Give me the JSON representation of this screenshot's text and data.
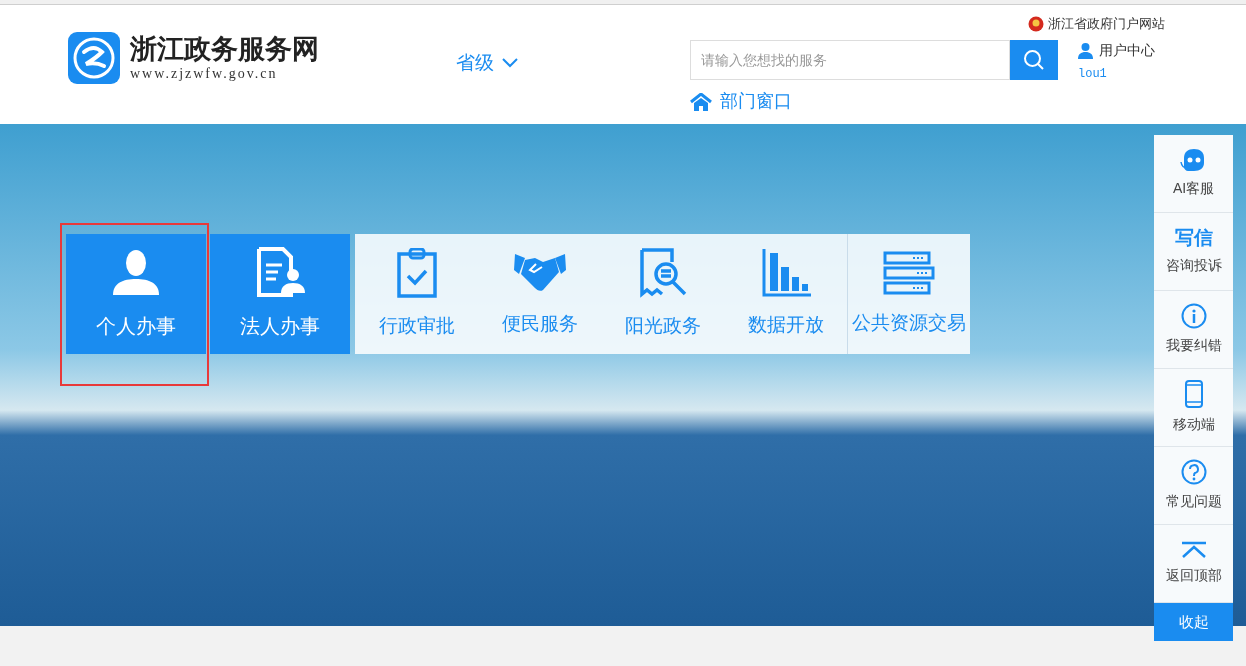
{
  "header": {
    "logo_title": "浙江政务服务网",
    "logo_url": "www.zjzwfw.gov.cn",
    "region": "省级",
    "portal_link": "浙江省政府门户网站",
    "search": {
      "placeholder": "请输入您想找的服务"
    },
    "dept_link": "部门窗口",
    "user_center": "用户中心",
    "username": "lou1"
  },
  "tiles": [
    {
      "label": "个人办事",
      "kind": "primary",
      "highlighted": true
    },
    {
      "label": "法人办事",
      "kind": "primary",
      "highlighted": false
    },
    {
      "label": "行政审批",
      "kind": "secondary",
      "highlighted": false
    },
    {
      "label": "便民服务",
      "kind": "secondary",
      "highlighted": false
    },
    {
      "label": "阳光政务",
      "kind": "secondary",
      "highlighted": false
    },
    {
      "label": "数据开放",
      "kind": "secondary",
      "highlighted": false
    },
    {
      "label": "公共资源交易",
      "kind": "secondary",
      "highlighted": false
    }
  ],
  "sidebar": {
    "items": [
      {
        "label": "AI客服"
      },
      {
        "label": "咨询投诉",
        "icon_text": "写信"
      },
      {
        "label": "我要纠错"
      },
      {
        "label": "移动端"
      },
      {
        "label": "常见问题"
      },
      {
        "label": "返回顶部"
      }
    ],
    "collapse": "收起"
  }
}
